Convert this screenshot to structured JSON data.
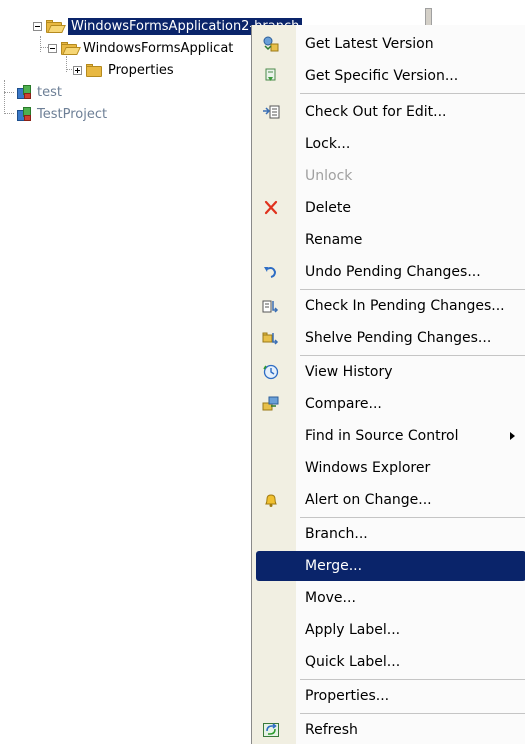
{
  "tree": {
    "items": [
      {
        "label": "WindowsFormsApplication2-branch",
        "selected": true
      },
      {
        "label": "WindowsFormsApplicat"
      },
      {
        "label": "Properties"
      },
      {
        "label": "test"
      },
      {
        "label": "TestProject"
      }
    ]
  },
  "menu": {
    "items": [
      {
        "label": "Get Latest Version",
        "icon": "get-latest-icon"
      },
      {
        "label": "Get Specific Version...",
        "icon": "get-specific-icon"
      },
      {
        "label": "Check Out for Edit...",
        "icon": "check-out-icon"
      },
      {
        "label": "Lock..."
      },
      {
        "label": "Unlock",
        "disabled": true
      },
      {
        "label": "Delete",
        "icon": "delete-icon"
      },
      {
        "label": "Rename"
      },
      {
        "label": "Undo Pending Changes...",
        "icon": "undo-icon"
      },
      {
        "label": "Check In Pending Changes...",
        "icon": "check-in-icon"
      },
      {
        "label": "Shelve Pending Changes...",
        "icon": "shelve-icon"
      },
      {
        "label": "View History",
        "icon": "history-icon"
      },
      {
        "label": "Compare...",
        "icon": "compare-icon"
      },
      {
        "label": "Find in Source Control",
        "submenu": true
      },
      {
        "label": "Windows Explorer"
      },
      {
        "label": "Alert on Change...",
        "icon": "bell-icon"
      },
      {
        "label": "Branch..."
      },
      {
        "label": "Merge...",
        "highlighted": true
      },
      {
        "label": "Move..."
      },
      {
        "label": "Apply Label..."
      },
      {
        "label": "Quick Label..."
      },
      {
        "label": "Properties..."
      },
      {
        "label": "Refresh",
        "icon": "refresh-icon"
      }
    ]
  },
  "colors": {
    "selection": "#0a246a",
    "gutter": "#f1efe2",
    "delete": "#e0321e"
  }
}
